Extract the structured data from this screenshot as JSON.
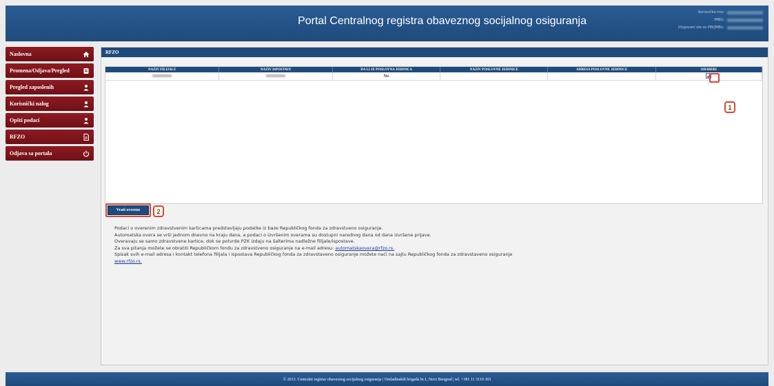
{
  "header": {
    "title": "Portal Centralnog registra obaveznog socijalnog osiguranja",
    "info": {
      "username_label": "Korisničko ime:",
      "imbg_label": "IMBG:",
      "logged_label": "Ulogovani ste za PIB/JMBG:"
    }
  },
  "sidebar": {
    "items": [
      {
        "label": "Naslovna",
        "icon": "home-icon"
      },
      {
        "label": "Promena/Odjava/Pregled",
        "icon": "form-icon"
      },
      {
        "label": "Pregled zaposlenih",
        "icon": "user-icon"
      },
      {
        "label": "Korisnički nalog",
        "icon": "user-icon"
      },
      {
        "label": "Opšti podaci",
        "icon": "user-icon"
      },
      {
        "label": "RFZO",
        "icon": "document-icon"
      },
      {
        "label": "Odjava sa portala",
        "icon": "power-icon"
      }
    ]
  },
  "content": {
    "title": "RFZO",
    "table": {
      "headers": [
        "NAZIV FILIJALE",
        "NAZIV ISPOSTAVE",
        "DA LI JE POSLOVNA JEDINICA",
        "NAZIV POSLOVNE JEDINICE",
        "ADRESA POSLOVNE JEDINICE",
        "ODABERI"
      ],
      "rows": [
        {
          "poslovna": "Ne"
        }
      ]
    },
    "button_label": "Vrati overene",
    "callout_1": "1",
    "callout_2": "2",
    "info_lines": [
      "Podaci o overenim zdravstvenim karticama predstavljaju podatke iz baze Republičkog fonda za zdravstveno osiguranje.",
      "Automatska overa se vrši jednom dnevno na kraju dana, a podaci o izvršenim overama su dostupni narednog dana od dana izvršene prijave.",
      "Overavaju se samo zdravstvene kartice, dok se potvrde PZK izdaju na šalterima nadležne filijale/ispostave."
    ],
    "email_prefix": "Za sva pitanja možete se obratiti Republičkom fondu za zdravstveno osiguranje na e-mail adresu: ",
    "email_link": "automatskaovera@rfzo.rs.",
    "contact_line": "Spisak svih e-mail adresa i kontakt telefona filijala i ispostava Republičkog fonda za zdravstaveno osiguranje možete naći na sajtu Republičkog fonda za zdravstaveno osiguranje",
    "website_link": "www.rfzo.rs."
  },
  "footer": {
    "text": "© 2013. Centralni registar obaveznog socijalnog osiguranja | Omladinskih brigada br.1, Novi Beograd | tel. +381 11 3110 365"
  },
  "colors": {
    "header_blue": "#1f4a7c",
    "nav_red": "#8e1b22",
    "callout_red": "#d7453d"
  }
}
